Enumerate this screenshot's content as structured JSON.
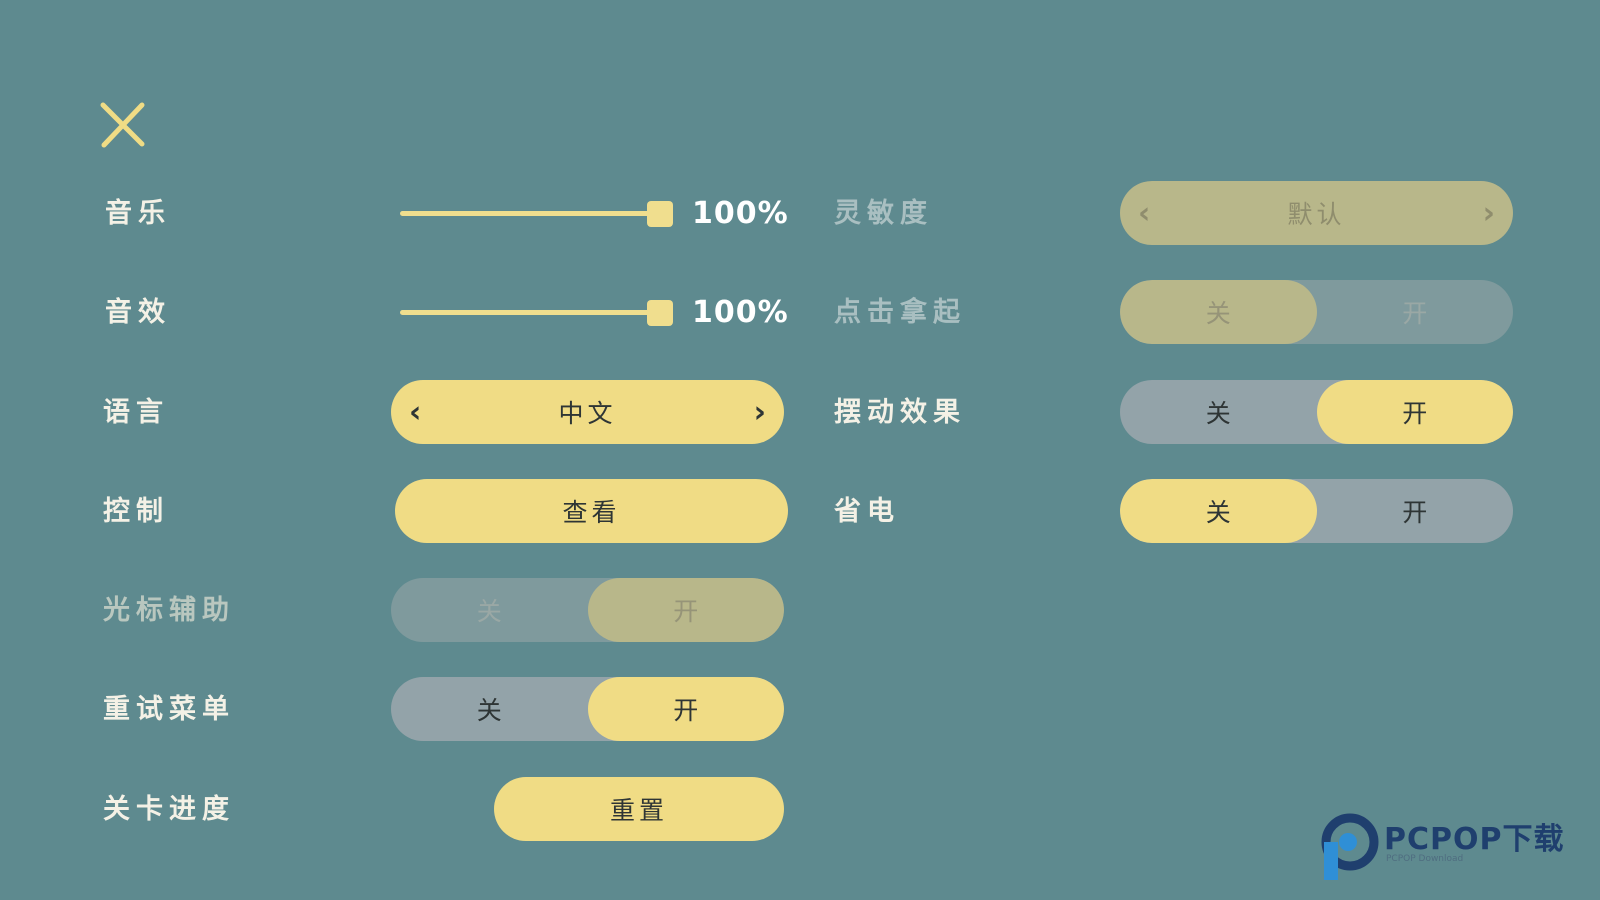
{
  "left": {
    "music": {
      "label": "音乐",
      "value": 100,
      "display": "100%"
    },
    "sfx": {
      "label": "音效",
      "value": 100,
      "display": "100%"
    },
    "language": {
      "label": "语言",
      "value": "中文",
      "prev": "‹",
      "next": "›"
    },
    "controls": {
      "label": "控制",
      "button": "查看"
    },
    "cursor_assist": {
      "label": "光标辅助",
      "off": "关",
      "on": "开",
      "selected": "on",
      "enabled": false
    },
    "retry_menu": {
      "label": "重试菜单",
      "off": "关",
      "on": "开",
      "selected": "on"
    },
    "progress": {
      "label": "关卡进度",
      "button": "重置"
    }
  },
  "right": {
    "sensitivity": {
      "label": "灵敏度",
      "value": "默认",
      "prev": "‹",
      "next": "›",
      "enabled": false
    },
    "tap_pickup": {
      "label": "点击拿起",
      "off": "关",
      "on": "开",
      "selected": "off",
      "enabled": false
    },
    "sway": {
      "label": "摆动效果",
      "off": "关",
      "on": "开",
      "selected": "on"
    },
    "power_save": {
      "label": "省电",
      "off": "关",
      "on": "开",
      "selected": "off"
    }
  },
  "watermark": {
    "brand": "PCPOP下载",
    "sub": "PCPOP Download"
  },
  "colors": {
    "background": "#5e8a8f",
    "accent": "#f0dc85",
    "off": "#93a3a9",
    "disabled": "#b8b78a"
  },
  "icons": {
    "close": "close-icon",
    "prev": "chevron-left-icon",
    "next": "chevron-right-icon"
  }
}
